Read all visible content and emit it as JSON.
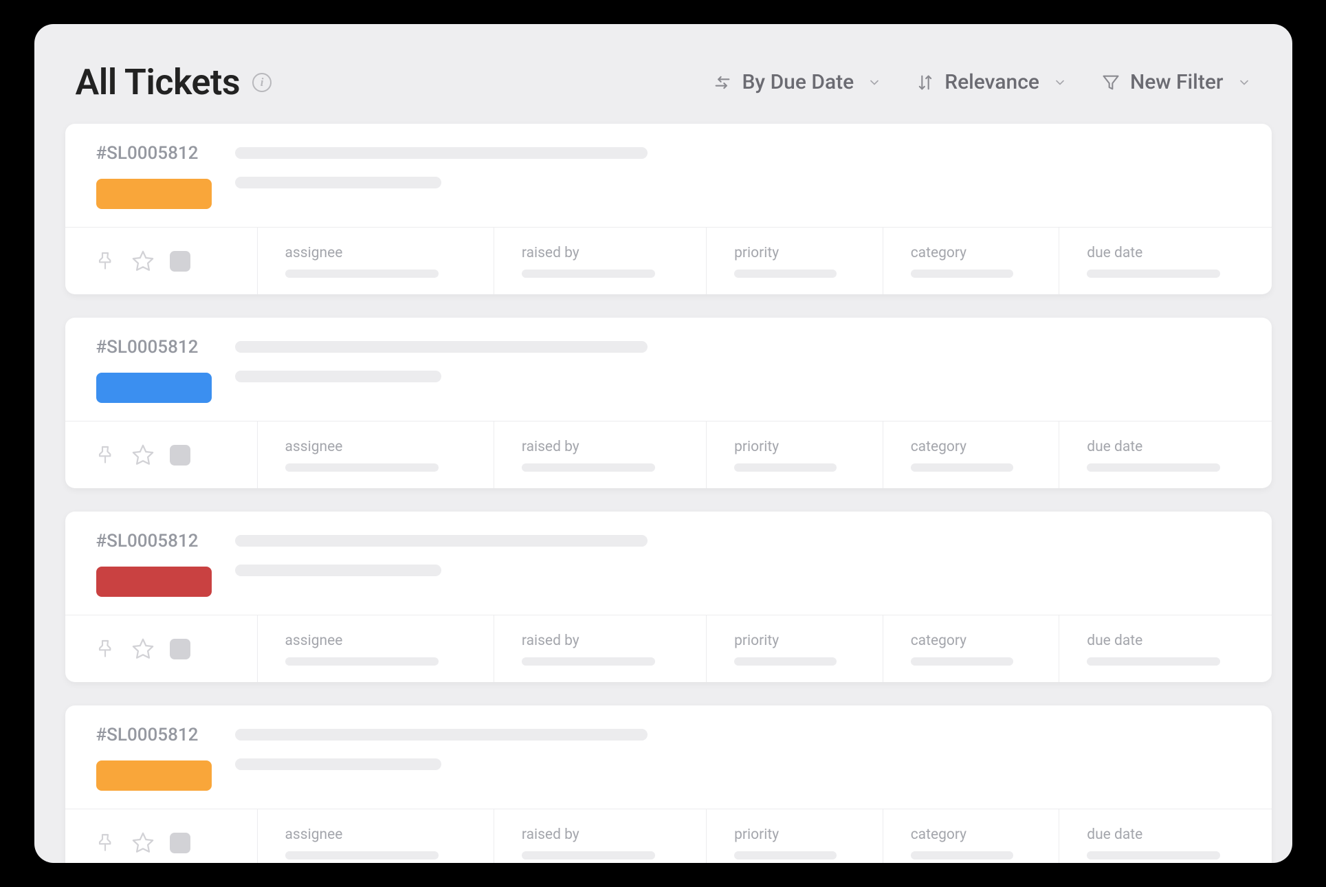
{
  "header": {
    "title": "All Tickets",
    "sort_primary": "By Due Date",
    "sort_secondary": "Relevance",
    "filter_label": "New Filter"
  },
  "colors": {
    "orange": "#f9a63a",
    "blue": "#3b8ff0",
    "red": "#c94141"
  },
  "meta_labels": {
    "assignee": "assignee",
    "raised_by": "raised by",
    "priority": "priority",
    "category": "category",
    "due_date": "due date"
  },
  "tickets": [
    {
      "id": "#SL0005812",
      "status_color": "orange"
    },
    {
      "id": "#SL0005812",
      "status_color": "blue"
    },
    {
      "id": "#SL0005812",
      "status_color": "red"
    },
    {
      "id": "#SL0005812",
      "status_color": "orange"
    }
  ]
}
